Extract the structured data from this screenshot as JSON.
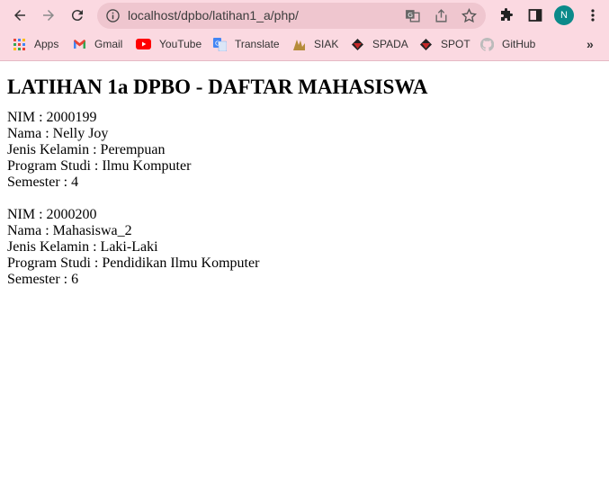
{
  "browser": {
    "url": "localhost/dpbo/latihan1_a/php/",
    "profile_initial": "N",
    "accent": "#fbd9e1",
    "bookmarks": [
      {
        "label": "Apps",
        "icon": "apps-grid-icon"
      },
      {
        "label": "Gmail",
        "icon": "gmail-icon"
      },
      {
        "label": "YouTube",
        "icon": "youtube-icon"
      },
      {
        "label": "Translate",
        "icon": "translate-icon"
      },
      {
        "label": "SIAK",
        "icon": "siak-icon"
      },
      {
        "label": "SPADA",
        "icon": "spada-icon"
      },
      {
        "label": "SPOT",
        "icon": "spot-icon"
      },
      {
        "label": "GitHub",
        "icon": "github-icon"
      }
    ],
    "overflow_label": "»"
  },
  "page": {
    "title": "LATIHAN 1a DPBO - DAFTAR MAHASISWA",
    "students": [
      {
        "nim": "NIM : 2000199",
        "nama": "Nama : Nelly Joy",
        "jenis_kelamin": "Jenis Kelamin : Perempuan",
        "prodi": "Program Studi : Ilmu Komputer",
        "semester": "Semester : 4"
      },
      {
        "nim": "NIM : 2000200",
        "nama": "Nama : Mahasiswa_2",
        "jenis_kelamin": "Jenis Kelamin : Laki-Laki",
        "prodi": "Program Studi : Pendidikan Ilmu Komputer",
        "semester": "Semester : 6"
      }
    ]
  }
}
